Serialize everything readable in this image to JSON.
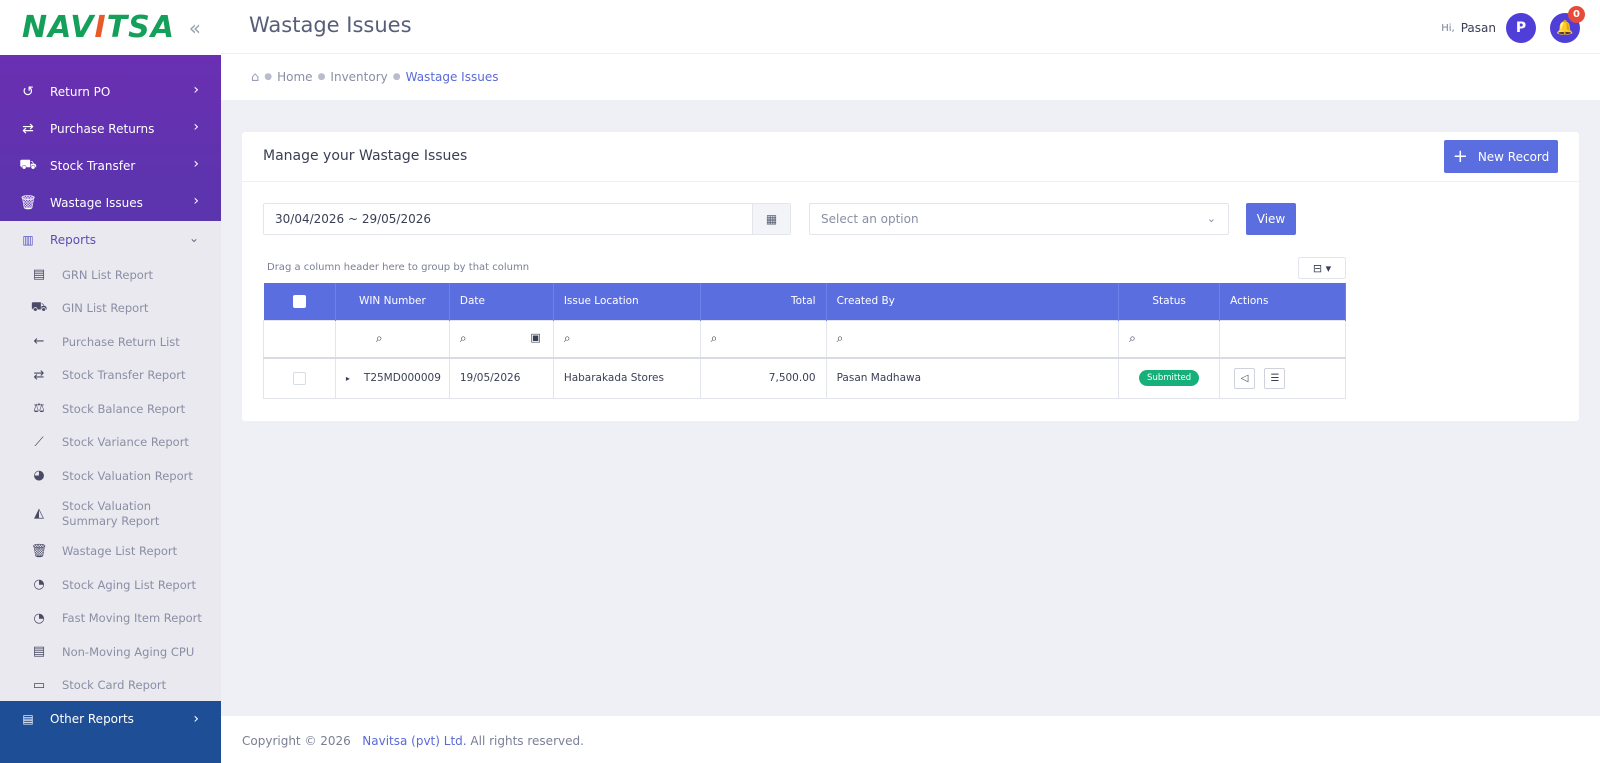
{
  "logo": {
    "part1": "NAV",
    "accent": "I",
    "part2": "TSA"
  },
  "sidebar": {
    "top_items": [
      {
        "label": "Return PO",
        "icon": "undo-icon"
      },
      {
        "label": "Purchase Returns",
        "icon": "swap-icon"
      },
      {
        "label": "Stock Transfer",
        "icon": "truck-icon"
      },
      {
        "label": "Wastage Issues",
        "icon": "trash-icon"
      }
    ],
    "reports_label": "Reports",
    "reports": [
      "GRN List Report",
      "GIN List Report",
      "Purchase Return List",
      "Stock Transfer Report",
      "Stock Balance Report",
      "Stock Variance Report",
      "Stock Valuation Report",
      "Stock Valuation Summary Report",
      "Wastage List Report",
      "Stock Aging List Report",
      "Fast Moving Item Report",
      "Non-Moving Aging CPU",
      "Stock Card Report"
    ],
    "other_reports_label": "Other Reports"
  },
  "header": {
    "title": "Wastage Issues",
    "hi": "Hi,",
    "user_name": "Pasan",
    "avatar_initial": "P",
    "notification_count": "0"
  },
  "breadcrumb": {
    "home": "Home",
    "inventory": "Inventory",
    "current": "Wastage Issues"
  },
  "card": {
    "title": "Manage your Wastage Issues",
    "new_record_label": "New Record",
    "date_range": "30/04/2026 ~ 29/05/2026",
    "select_placeholder": "Select an option",
    "view_label": "View",
    "group_hint": "Drag a column header here to group by that column"
  },
  "table": {
    "columns": [
      "WIN Number",
      "Date",
      "Issue Location",
      "Total",
      "Created By",
      "Status",
      "Actions"
    ],
    "rows": [
      {
        "win": "T25MD000009",
        "date": "19/05/2026",
        "location": "Habarakada Stores",
        "total": "7,500.00",
        "created_by": "Pasan Madhawa",
        "status": "Submitted"
      }
    ]
  },
  "footer": {
    "copyright": "Copyright © 2026",
    "company": "Navitsa (pvt) Ltd.",
    "rights": "All rights reserved."
  },
  "colors": {
    "primary": "#5a6ee0",
    "sidebar_purple": "#6a2fb2",
    "sidebar_blue": "#1e4f96",
    "status_green": "#16b07a"
  }
}
